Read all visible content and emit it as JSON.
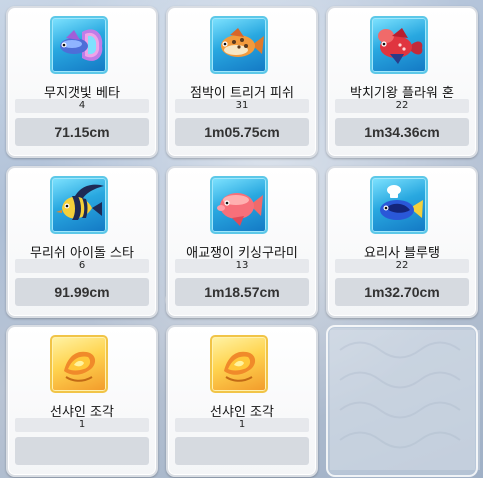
{
  "items": [
    {
      "name": "무지갯빛 베타",
      "count": "4",
      "size": "71.15cm",
      "icon": "rainbow-betta-fish-icon",
      "frame": "blue"
    },
    {
      "name": "점박이 트리거 피쉬",
      "count": "31",
      "size": "1m05.75cm",
      "icon": "spotted-triggerfish-icon",
      "frame": "blue"
    },
    {
      "name": "박치기왕 플라워 혼",
      "count": "22",
      "size": "1m34.36cm",
      "icon": "flowerhorn-fish-icon",
      "frame": "blue"
    },
    {
      "name": "무리쉬 아이돌 스타",
      "count": "6",
      "size": "91.99cm",
      "icon": "moorish-idol-fish-icon",
      "frame": "blue"
    },
    {
      "name": "애교쟁이 키싱구라미",
      "count": "13",
      "size": "1m18.57cm",
      "icon": "kissing-gourami-fish-icon",
      "frame": "blue"
    },
    {
      "name": "요리사 블루탱",
      "count": "22",
      "size": "1m32.70cm",
      "icon": "chef-blue-tang-fish-icon",
      "frame": "blue"
    },
    {
      "name": "선샤인 조각",
      "count": "1",
      "size": "",
      "icon": "sunshine-fragment-icon",
      "frame": "gold"
    },
    {
      "name": "선샤인 조각",
      "count": "1",
      "size": "",
      "icon": "sunshine-fragment-icon",
      "frame": "gold"
    }
  ]
}
